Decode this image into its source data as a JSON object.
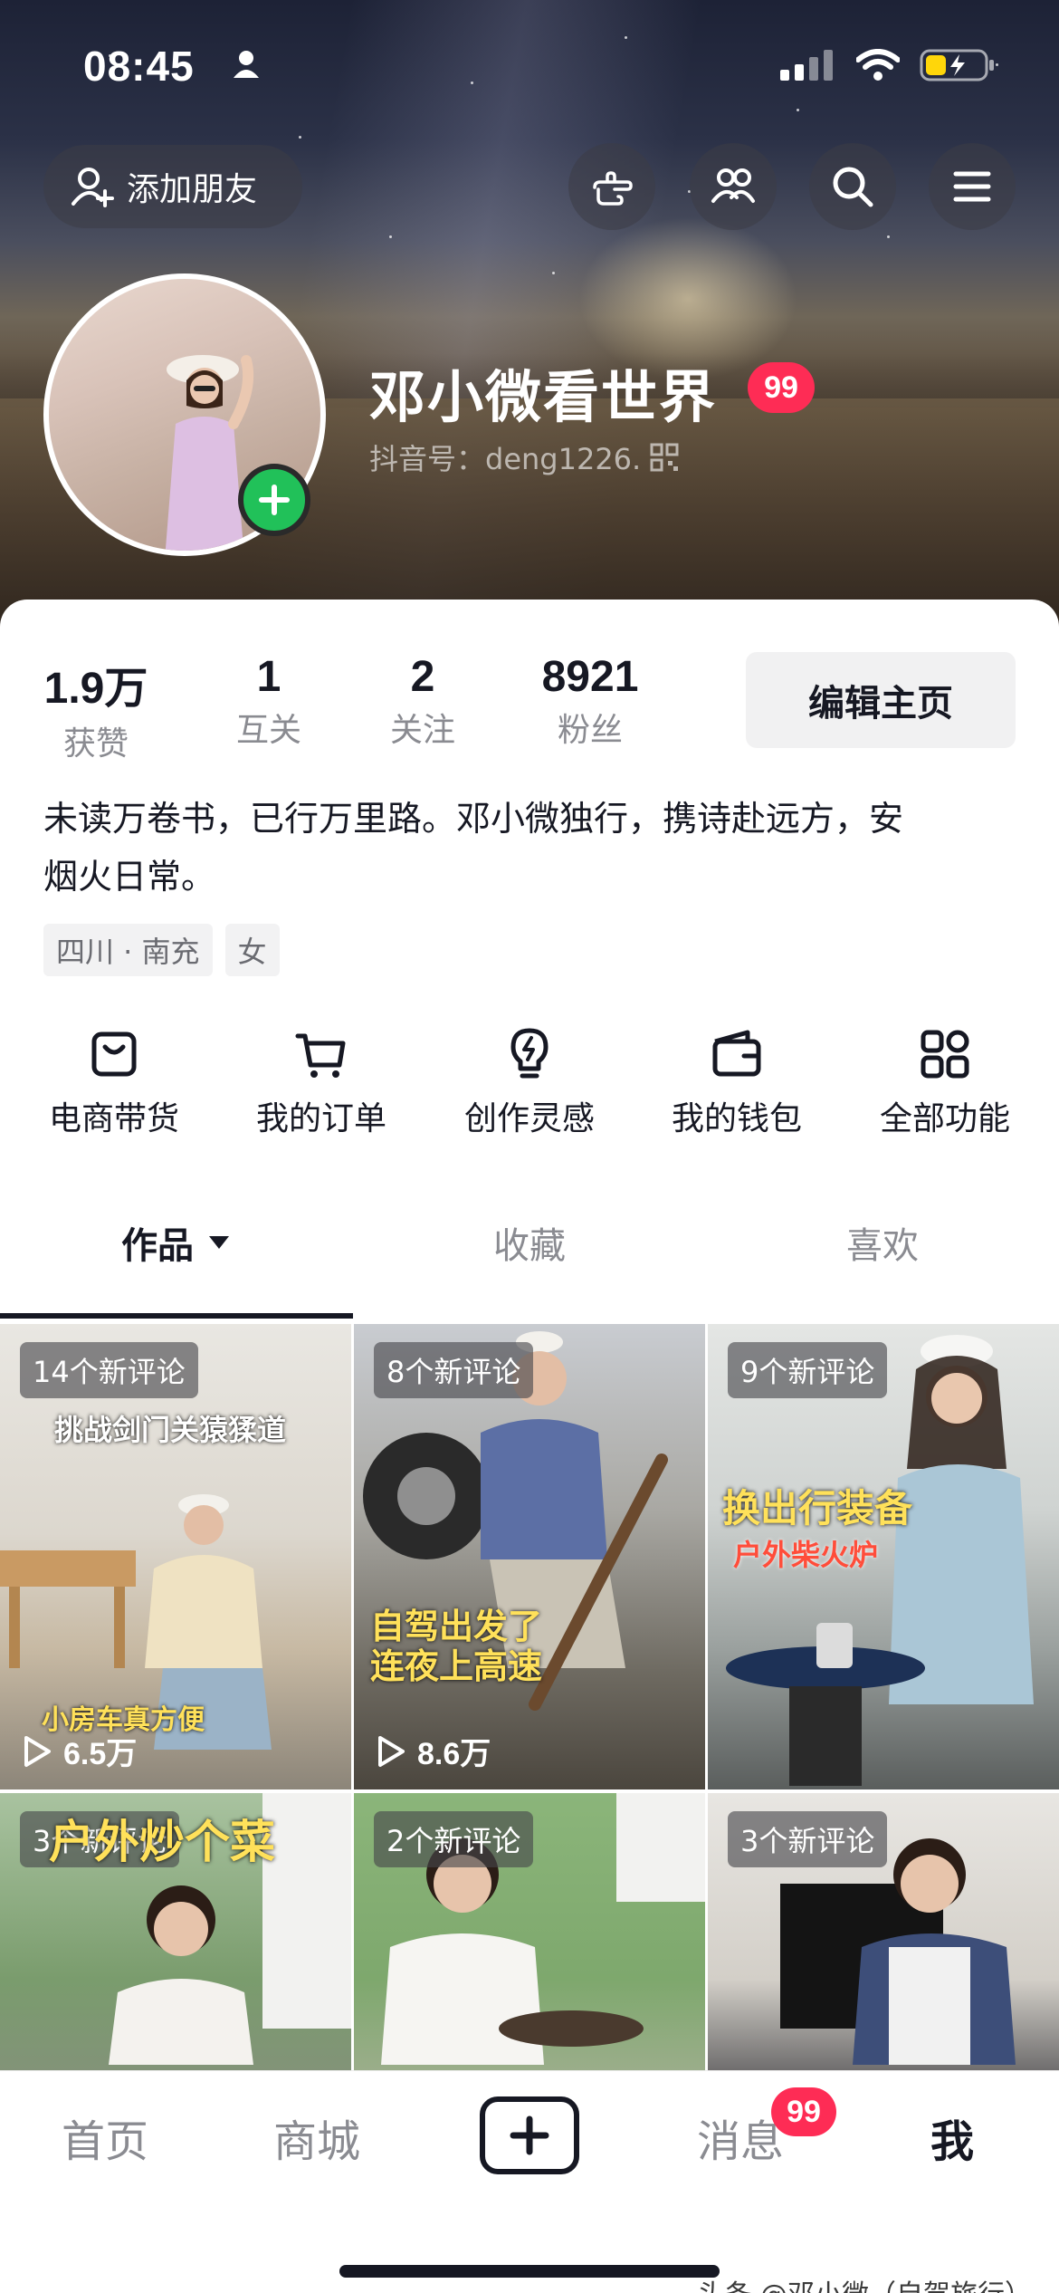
{
  "status_bar": {
    "time": "08:45",
    "icons": [
      "person-icon",
      "signal-icon",
      "wifi-icon",
      "battery-charging-icon"
    ]
  },
  "header": {
    "add_friend_label": "添加朋友",
    "buttons": [
      "hand-point-icon",
      "friends-icon",
      "search-icon",
      "menu-icon"
    ]
  },
  "profile": {
    "nickname": "邓小微看世界",
    "badge": "99",
    "douyin_id": "抖音号：deng1226.",
    "stats": [
      {
        "value": "1.9万",
        "label": "获赞"
      },
      {
        "value": "1",
        "label": "互关"
      },
      {
        "value": "2",
        "label": "关注"
      },
      {
        "value": "8921",
        "label": "粉丝"
      }
    ],
    "edit_label": "编辑主页",
    "bio_line1": "未读万卷书，已行万里路。邓小微独行，携诗赴远方，安",
    "bio_line2": "烟火日常。",
    "tags": [
      "四川 · 南充",
      "女"
    ]
  },
  "features": [
    {
      "label": "电商带货",
      "icon": "shopping-bag-icon"
    },
    {
      "label": "我的订单",
      "icon": "cart-icon"
    },
    {
      "label": "创作灵感",
      "icon": "bulb-icon"
    },
    {
      "label": "我的钱包",
      "icon": "wallet-icon"
    },
    {
      "label": "全部功能",
      "icon": "grid-apps-icon"
    }
  ],
  "tabs": [
    "作品",
    "收藏",
    "喜欢"
  ],
  "videos": [
    {
      "badge": "14个新评论",
      "caption_top": "挑战剑门关猿猱道",
      "caption_bottom": "小房车真方便",
      "plays": "6.5万"
    },
    {
      "badge": "8个新评论",
      "caption_top": "",
      "caption_bottom": "自驾出发了\n连夜上高速",
      "plays": "8.6万"
    },
    {
      "badge": "9个新评论",
      "caption_top": "换出行装备",
      "caption_bottom": "户外柴火炉",
      "plays": ""
    },
    {
      "badge": "3个新评论",
      "caption_top": "户外炒个菜",
      "caption_bottom": "",
      "plays": ""
    },
    {
      "badge": "2个新评论",
      "caption_top": "",
      "caption_bottom": "",
      "plays": ""
    },
    {
      "badge": "3个新评论",
      "caption_top": "",
      "caption_bottom": "",
      "plays": ""
    }
  ],
  "bottom_nav": {
    "items": [
      "首页",
      "商城",
      "消息",
      "我"
    ],
    "message_badge": "99"
  },
  "watermark": "头条 @邓小微（自驾旅行）",
  "colors": {
    "accent": "#fe2c55",
    "green": "#21c159",
    "text": "#161823",
    "muted": "#8a8b91"
  }
}
